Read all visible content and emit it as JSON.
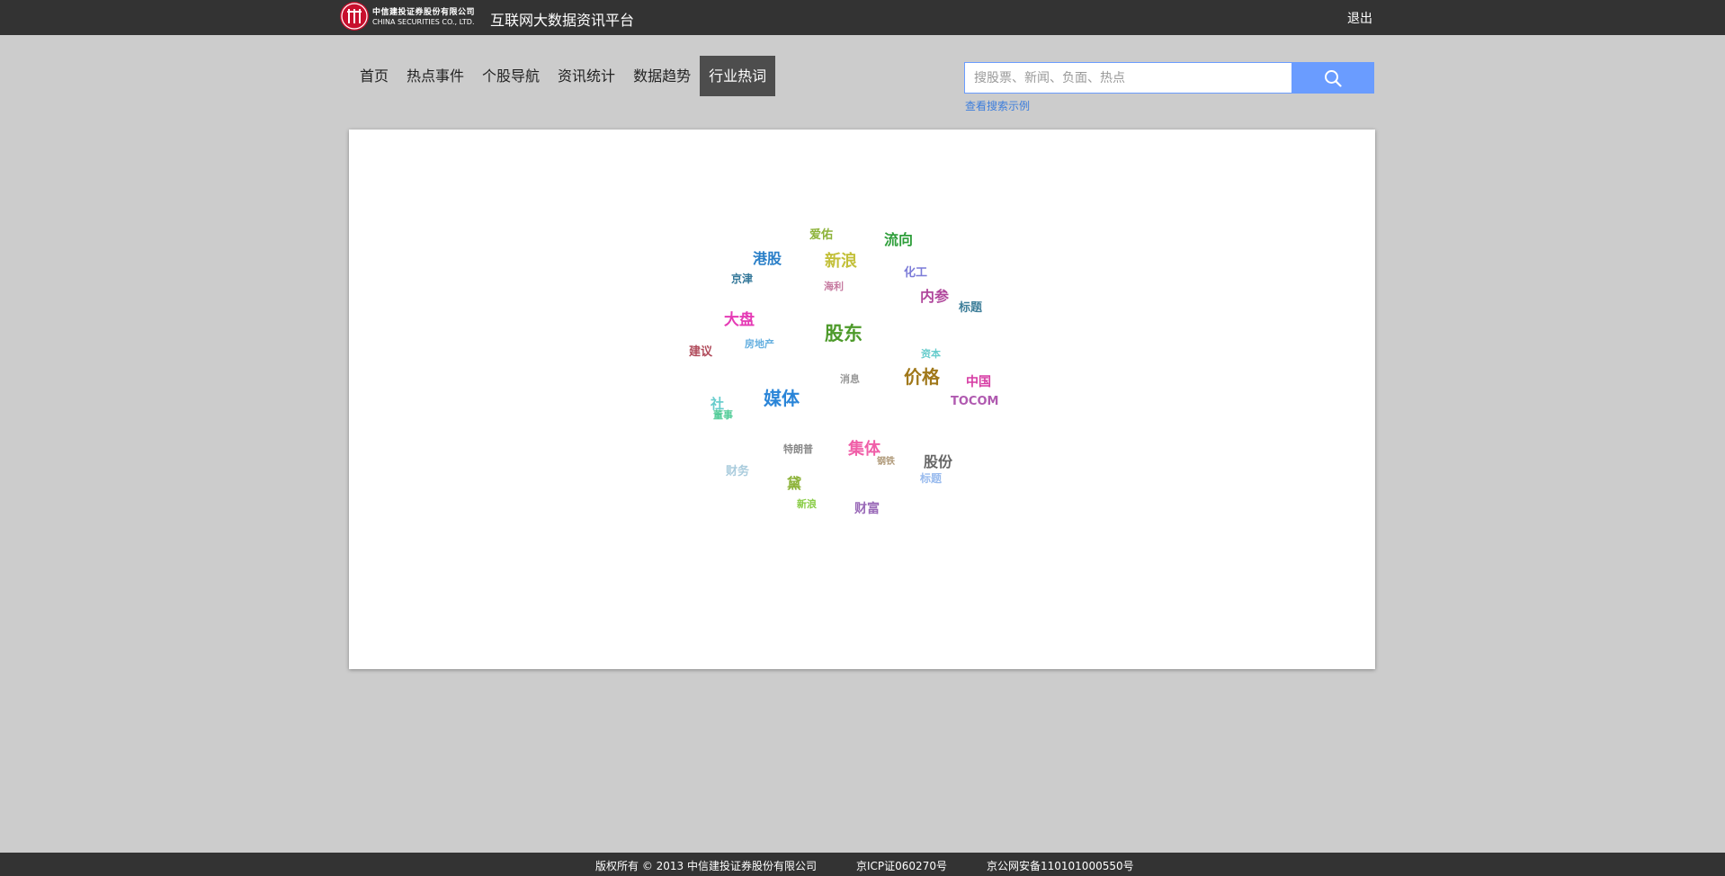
{
  "header": {
    "logo_cn": "中信建投证券股份有限公司",
    "logo_en": "CHINA SECURITIES CO., LTD.",
    "title": "互联网大数据资讯平台",
    "logout": "退出"
  },
  "nav": {
    "items": [
      {
        "label": "首页"
      },
      {
        "label": "热点事件"
      },
      {
        "label": "个股导航"
      },
      {
        "label": "资讯统计"
      },
      {
        "label": "数据趋势"
      },
      {
        "label": "行业热词",
        "active": true
      }
    ]
  },
  "search": {
    "placeholder": "搜股票、新闻、负面、热点",
    "value": "",
    "example_link": "查看搜索示例",
    "icon": "search-icon"
  },
  "word_cloud": {
    "words": [
      {
        "text": "爱佑",
        "color": "#8db33a"
      },
      {
        "text": "流向",
        "color": "#2e9e3a"
      },
      {
        "text": "港股",
        "color": "#2a7fc8"
      },
      {
        "text": "新浪",
        "color": "#c3c03a"
      },
      {
        "text": "化工",
        "color": "#7c7cd8"
      },
      {
        "text": "京津",
        "color": "#337799"
      },
      {
        "text": "海利",
        "color": "#c67aa0"
      },
      {
        "text": "内参",
        "color": "#b0479c"
      },
      {
        "text": "标题",
        "color": "#3f7f9a"
      },
      {
        "text": "大盘",
        "color": "#e53bb5"
      },
      {
        "text": "股东",
        "color": "#4d9a2a"
      },
      {
        "text": "房地产",
        "color": "#66b0e0"
      },
      {
        "text": "建议",
        "color": "#b04a5a"
      },
      {
        "text": "资本",
        "color": "#66cccc"
      },
      {
        "text": "消息",
        "color": "#999999"
      },
      {
        "text": "价格",
        "color": "#a0781a"
      },
      {
        "text": "中国",
        "color": "#d63ba3"
      },
      {
        "text": "媒体",
        "color": "#2a85d8"
      },
      {
        "text": "社",
        "color": "#66cccc"
      },
      {
        "text": "TOCOM",
        "color": "#b05ab0"
      },
      {
        "text": "董事",
        "color": "#55cc99"
      },
      {
        "text": "特朗普",
        "color": "#888888"
      },
      {
        "text": "集体",
        "color": "#f05fa8"
      },
      {
        "text": "钢铁",
        "color": "#b09a7a"
      },
      {
        "text": "股份",
        "color": "#666666"
      },
      {
        "text": "财务",
        "color": "#aaccdd"
      },
      {
        "text": "标题",
        "color": "#99bbee"
      },
      {
        "text": "黛",
        "color": "#8db33a"
      },
      {
        "text": "新浪",
        "color": "#88cc44"
      },
      {
        "text": "财富",
        "color": "#9a6ab8"
      }
    ]
  },
  "footer": {
    "copyright": "版权所有 © 2013 中信建投证券股份有限公司",
    "icp": "京ICP证060270号",
    "police": "京公网安备110101000550号"
  }
}
